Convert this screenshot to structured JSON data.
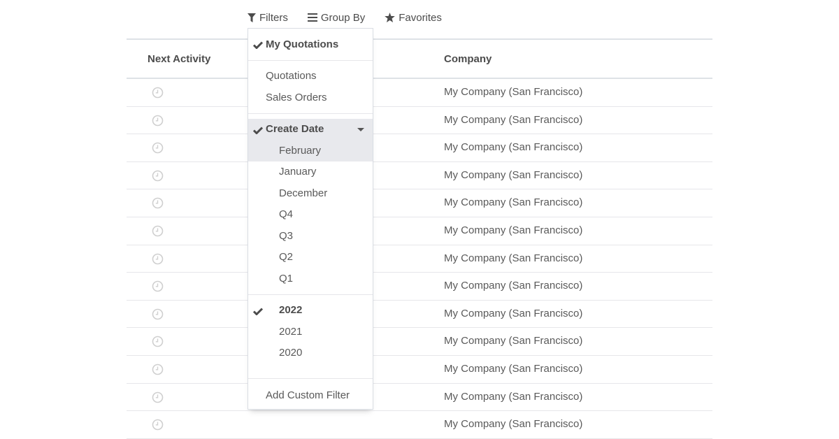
{
  "toolbar": {
    "filters_label": "Filters",
    "group_by_label": "Group By",
    "favorites_label": "Favorites"
  },
  "table": {
    "columns": {
      "next_activity": "Next Activity",
      "company": "Company"
    },
    "rows": [
      {
        "company": "My Company (San Francisco)"
      },
      {
        "company": "My Company (San Francisco)"
      },
      {
        "company": "My Company (San Francisco)"
      },
      {
        "company": "My Company (San Francisco)"
      },
      {
        "company": "My Company (San Francisco)"
      },
      {
        "company": "My Company (San Francisco)"
      },
      {
        "company": "My Company (San Francisco)"
      },
      {
        "company": "My Company (San Francisco)"
      },
      {
        "company": "My Company (San Francisco)"
      },
      {
        "company": "My Company (San Francisco)"
      },
      {
        "company": "My Company (San Francisco)"
      },
      {
        "company": "My Company (San Francisco)"
      },
      {
        "company": "My Company (San Francisco)"
      }
    ]
  },
  "filters_menu": {
    "my_quotations": {
      "label": "My Quotations",
      "checked": true
    },
    "quotations": "Quotations",
    "sales_orders": "Sales Orders",
    "create_date": {
      "label": "Create Date",
      "checked": true
    },
    "date_options": [
      "February",
      "January",
      "December",
      "Q4",
      "Q3",
      "Q2",
      "Q1"
    ],
    "year_options": [
      {
        "label": "2022",
        "checked": true
      },
      {
        "label": "2021",
        "checked": false
      },
      {
        "label": "2020",
        "checked": false
      }
    ],
    "add_custom_filter": "Add Custom Filter"
  }
}
